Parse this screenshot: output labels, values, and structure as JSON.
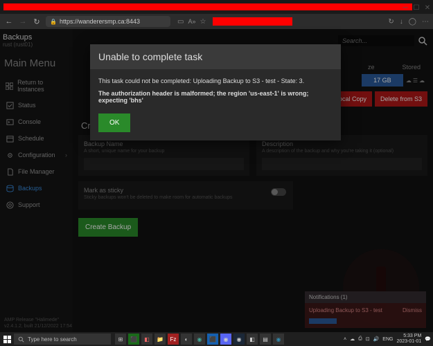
{
  "browser": {
    "url": "https://wanderersmp.ca:8443",
    "icons": {
      "refresh": "↻",
      "download": "↓",
      "user": "◯"
    }
  },
  "app_header": {
    "title": "Backups",
    "subtitle": "rust (rust01)"
  },
  "search": {
    "placeholder": "Search...",
    "icon": "🔍"
  },
  "menu_title": "Main Menu",
  "sidebar": {
    "items": [
      {
        "label": "Return to Instances"
      },
      {
        "label": "Status"
      },
      {
        "label": "Console"
      },
      {
        "label": "Schedule"
      },
      {
        "label": "Configuration"
      },
      {
        "label": "File Manager"
      },
      {
        "label": "Backups"
      },
      {
        "label": "Support"
      }
    ]
  },
  "table": {
    "headers": {
      "size": "ze",
      "stored": "Stored"
    },
    "row": {
      "size": "17 GB"
    },
    "actions": {
      "local": "Local Copy",
      "delete": "Delete from S3"
    }
  },
  "create": {
    "title": "Create a Backup",
    "name_label": "Backup Name",
    "name_hint": "A short, unique name for your backup",
    "desc_label": "Description",
    "desc_hint": "A description of the backup and why you're taking it (optional)",
    "sticky_label": "Mark as sticky",
    "sticky_hint": "Sticky backups won't be deleted to make room for automatic backups",
    "button": "Create Backup"
  },
  "modal": {
    "title": "Unable to complete task",
    "line1": "This task could not be completed: Uploading Backup to S3 - test - State: 3.",
    "line2": "The authorization header is malformed; the region 'us-east-1' is wrong; expecting 'bhs'",
    "ok": "OK"
  },
  "notif": {
    "header": "Notifications (1)",
    "text": "Uploading Backup to S3 - test",
    "dismiss": "Dismiss"
  },
  "version": {
    "line1": "AMP Release \"Halimede\"",
    "line2": "v2.4.1.2, built 21/12/2022 17:54"
  },
  "taskbar": {
    "search": "Type here to search",
    "lang": "ENG",
    "time": "5:33 PM",
    "date": "2023-01-01"
  }
}
